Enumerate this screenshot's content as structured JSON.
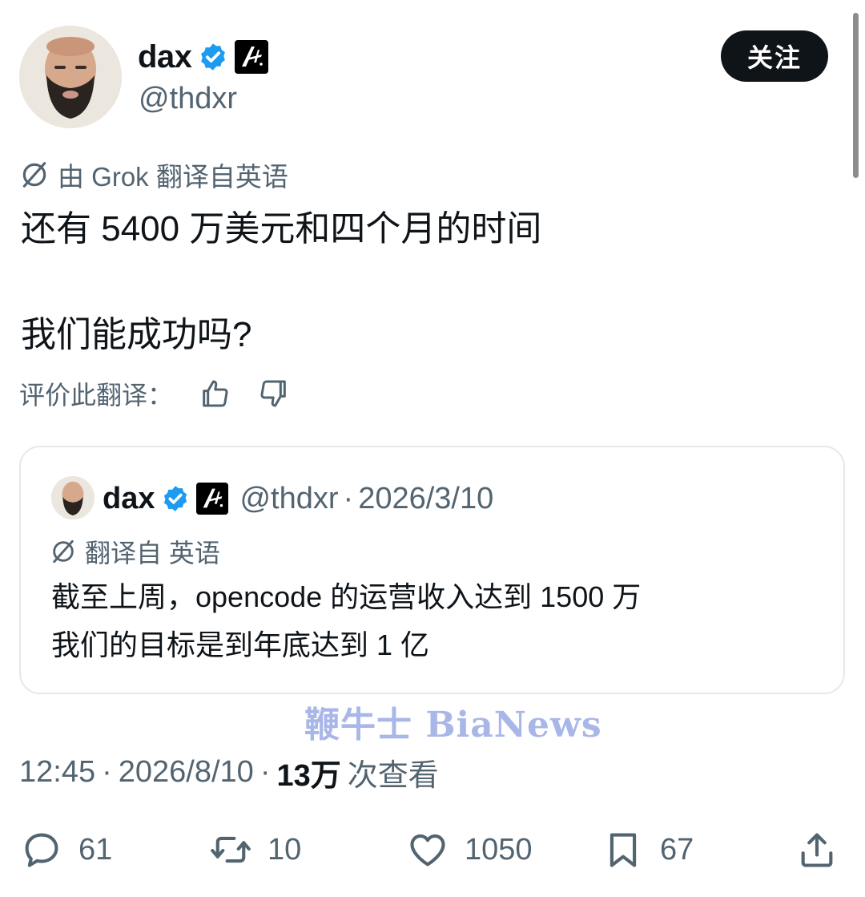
{
  "author": {
    "display_name": "dax",
    "handle": "@thdxr"
  },
  "follow_button": "关注",
  "translation_note": "由 Grok 翻译自英语",
  "tweet": {
    "line1": "还有 5400 万美元和四个月的时间",
    "line2": "我们能成功吗?"
  },
  "rate_translation": "评价此翻译：",
  "quote": {
    "display_name": "dax",
    "handle": "@thdxr",
    "separator": "·",
    "date": "2026/3/10",
    "translation_note": "翻译自 英语",
    "line1": "截至上周，opencode 的运营收入达到 1500 万",
    "line2": "我们的目标是到年底达到 1 亿"
  },
  "watermark": "鞭牛士 BiaNews",
  "meta": {
    "time": "12:45",
    "separator": "·",
    "date": "2026/8/10",
    "views_count": "13万",
    "views_label": "次查看"
  },
  "actions": {
    "replies": "61",
    "retweets": "10",
    "likes": "1050",
    "bookmarks": "67"
  },
  "icons": [
    "verified-badge-icon",
    "affiliate-icon",
    "translate-icon",
    "thumbs-up-icon",
    "thumbs-down-icon",
    "reply-icon",
    "retweet-icon",
    "like-icon",
    "bookmark-icon",
    "share-icon"
  ],
  "colors": {
    "text_primary": "#0f1419",
    "text_secondary": "#536471",
    "verified_blue": "#1d9bf0",
    "border": "#e4e8ec",
    "watermark": "#a9b7e8"
  }
}
